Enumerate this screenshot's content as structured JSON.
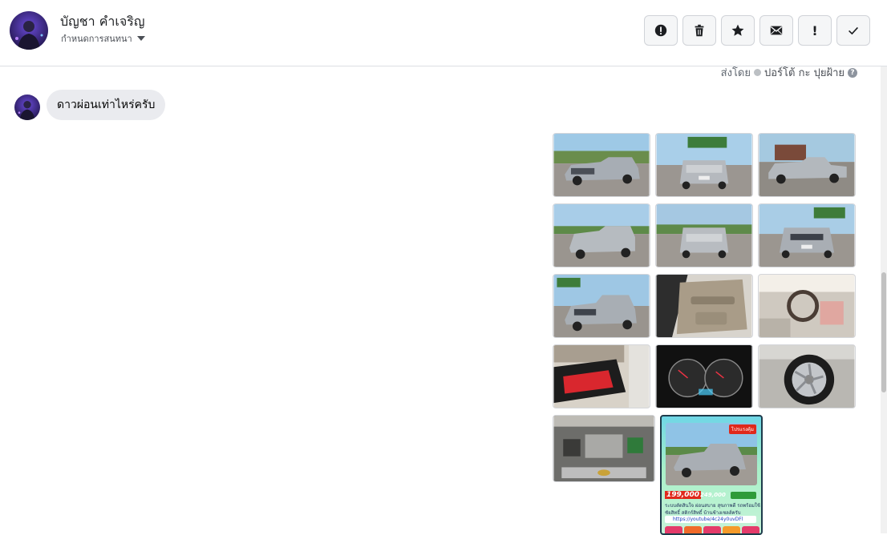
{
  "header": {
    "name": "บัญชา คำเจริญ",
    "subtitle": "กำหนดการสนทนา",
    "toolbar": [
      {
        "icon": "alert-circle-icon",
        "name": "report-button"
      },
      {
        "icon": "trash-icon",
        "name": "delete-button"
      },
      {
        "icon": "star-icon",
        "name": "star-button"
      },
      {
        "icon": "envelope-icon",
        "name": "mark-unread-button"
      },
      {
        "icon": "exclamation-icon",
        "name": "flag-button"
      },
      {
        "icon": "check-icon",
        "name": "done-button"
      }
    ]
  },
  "sent_by": {
    "prefix": "ส่งโดย",
    "author": "ปอร์โต้ กะ ปุยฝ้าย"
  },
  "message": {
    "text": "ดาวผ่อนเท่าไหร่ครับ"
  },
  "poster": {
    "tag": "โปรแรงคุ้ม",
    "price_main": "199,000",
    "price_sub": "249,000",
    "info": "ระบบตัดสินใจ ผ่อนสบาย สุขภาพดี รถพร้อมใช้",
    "seller": "ชัยสิทธิ์ สติกร์สิทธิ์ บ้านช้างเซลส์ครับ",
    "link": "https://youtube/4c24y0uvDFl"
  },
  "colors": {
    "avatar_bg": "#3b2a7a",
    "bubble": "#eaebef",
    "poster_price": "#e0281b"
  }
}
